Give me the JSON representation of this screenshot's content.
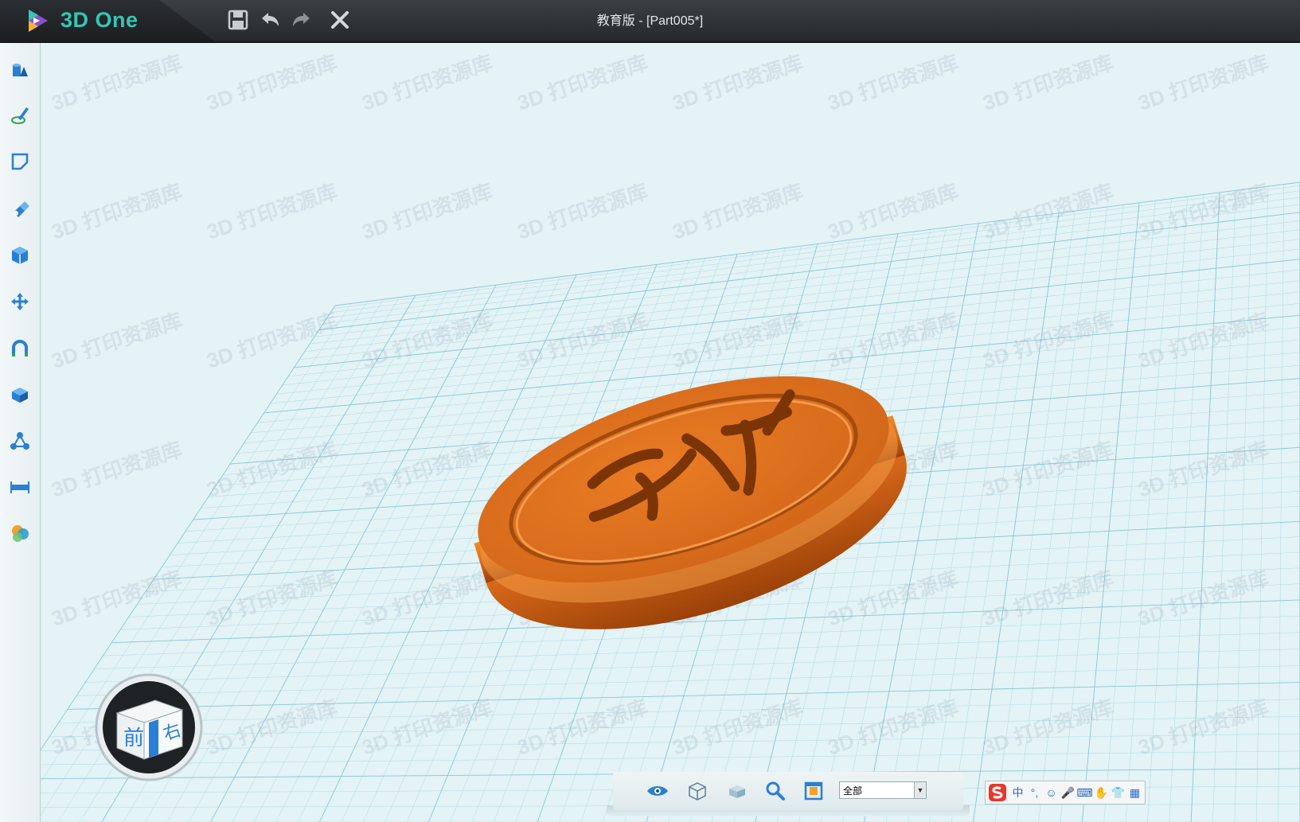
{
  "app": {
    "name": "3D One",
    "window_title": "教育版 - [Part005*]"
  },
  "titlebar": {
    "buttons": [
      {
        "name": "save-icon"
      },
      {
        "name": "undo-icon"
      },
      {
        "name": "redo-icon"
      },
      {
        "name": "close-icon"
      }
    ]
  },
  "left_toolbar": {
    "tools": [
      "basic-solid-icon",
      "draw-sketch-icon",
      "edit-sketch-icon",
      "special-function-icon",
      "combine-icon",
      "move-icon",
      "magnet-icon",
      "group-icon",
      "array-icon",
      "measure-icon",
      "material-color-icon"
    ]
  },
  "viewcube": {
    "front_label": "前",
    "right_label": "右"
  },
  "bottom_toolbar": {
    "filter_value": "全部",
    "icons": [
      "view-eye-icon",
      "view-wireframe-icon",
      "view-shaded-icon",
      "zoom-icon",
      "fit-view-icon"
    ]
  },
  "ime": {
    "items": [
      "中",
      "°,",
      "☺",
      "🎤",
      "⌨",
      "✋",
      "👕",
      "▦"
    ]
  },
  "watermark_text": "3D 打印资源库",
  "colors": {
    "accent": "#35c6b6",
    "model": "#e0771f",
    "grid": "#7cc0cf",
    "background": "#e3f3f6"
  }
}
